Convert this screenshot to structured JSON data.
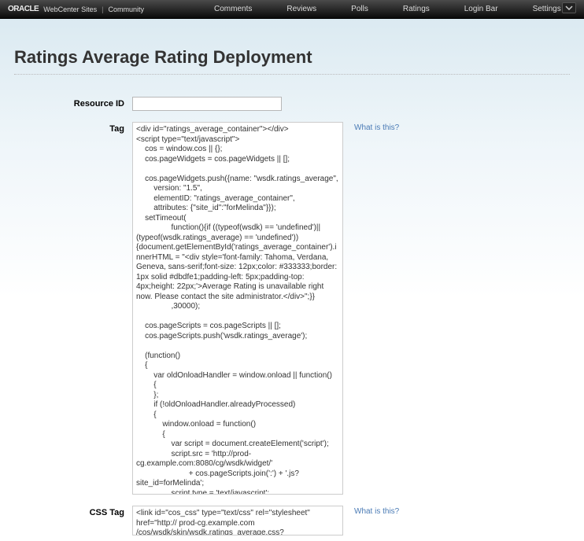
{
  "topbar": {
    "brand_oracle": "ORACLE",
    "brand_product": "WebCenter Sites",
    "brand_sep": "|",
    "brand_community": "Community",
    "nav": [
      "Comments",
      "Reviews",
      "Polls",
      "Ratings",
      "Login Bar",
      "Settings"
    ]
  },
  "page": {
    "title": "Ratings Average Rating Deployment"
  },
  "form": {
    "resource_id_label": "Resource ID",
    "resource_id_value": "",
    "tag_label": "Tag",
    "tag_value": "<div id=\"ratings_average_container\"></div>\n<script type=\"text/javascript\">\n    cos = window.cos || {};\n    cos.pageWidgets = cos.pageWidgets || [];\n\n    cos.pageWidgets.push({name: \"wsdk.ratings_average\",\n        version: \"1.5\",\n        elementID: \"ratings_average_container\",\n        attributes: {\"site_id\":\"forMelinda\"}});\n    setTimeout(\n                function(){if ((typeof(wsdk) == 'undefined')||(typeof(wsdk.ratings_average) == 'undefined')) {document.getElementById('ratings_average_container').innerHTML = \"<div style='font-family: Tahoma, Verdana, Geneva, sans-serif;font-size: 12px;color: #333333;border: 1px solid #dbdfe1;padding-left: 5px;padding-top: 4px;height: 22px;'>Average Rating is unavailable right now. Please contact the site administrator.</div>\";}}\n                ,30000);\n\n    cos.pageScripts = cos.pageScripts || [];\n    cos.pageScripts.push('wsdk.ratings_average');\n\n    (function()\n    {\n        var oldOnloadHandler = window.onload || function()\n        {\n        };\n        if (!oldOnloadHandler.alreadyProcessed)\n        {\n            window.onload = function()\n            {\n                var script = document.createElement('script');\n                script.src = 'http://prod-cg.example.com:8080/cg/wsdk/widget/'\n                        + cos.pageScripts.join(':') + '.js?site_id=forMelinda';\n                script.type = 'text/javascript';\n                script.charset = 'utf-8';\n\ndocument.getElementsByTagName(\"head\").item(0).appendChild(script);\n                oldOnloadHandler.apply(this, arguments);\n            };\n            window.onload.alreadyProcessed = true;\n        }\n\n    })();\n</script>",
    "css_tag_label": "CSS Tag",
    "css_tag_value": "<link id=\"cos_css\" type=\"text/css\" rel=\"stylesheet\" href=\"http:// prod-cg.example.com /cos/wsdk/skin/wsdk.ratings_average.css?site_id=forMelinda&gateway=true\" />",
    "what_is_this": "What is this?"
  }
}
